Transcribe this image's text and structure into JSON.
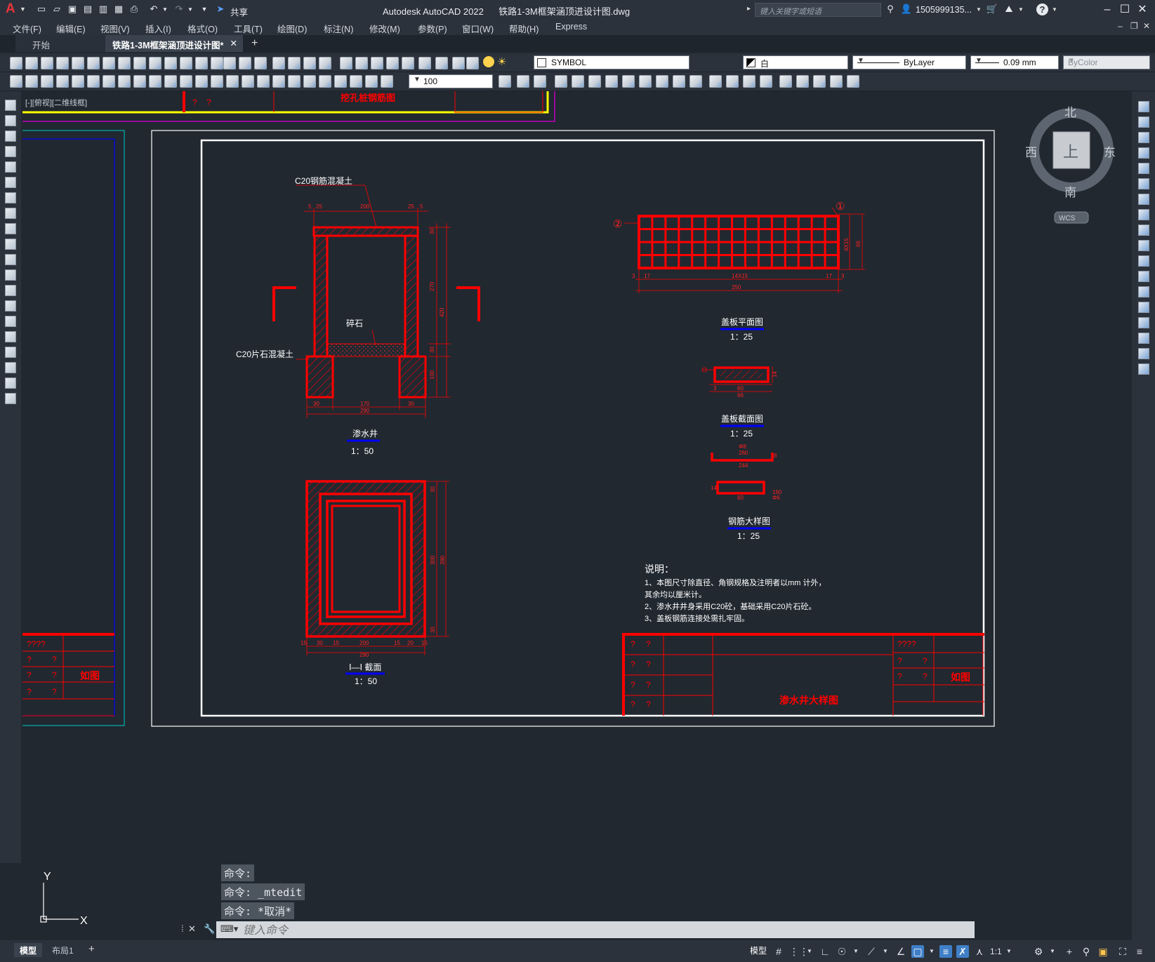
{
  "app": {
    "title": "Autodesk AutoCAD 2022",
    "filename": "铁路1-3M框架涵顶进设计图.dwg",
    "logo": "A",
    "share_label": "共享",
    "search_placeholder": "键入关键字或短语",
    "user": "1505999135...",
    "help": "?"
  },
  "menu": [
    "文件(F)",
    "编辑(E)",
    "视图(V)",
    "插入(I)",
    "格式(O)",
    "工具(T)",
    "绘图(D)",
    "标注(N)",
    "修改(M)",
    "参数(P)",
    "窗口(W)",
    "帮助(H)",
    "Express"
  ],
  "tabs": {
    "start": "开始",
    "active": "铁路1-3M框架涵顶进设计图*",
    "close": "✕",
    "add": "+"
  },
  "toolbar": {
    "layer": "SYMBOL",
    "color": "白",
    "linetype": "ByLayer",
    "lineweight": "0.09 mm",
    "plotstyle": "ByColor",
    "scale": "100"
  },
  "viewport_label": "[-][俯视][二维线框]",
  "viewcube": {
    "north": "北",
    "south": "南",
    "east": "东",
    "west": "西",
    "top": "上",
    "wcs": "WCS"
  },
  "ucs": {
    "x": "X",
    "y": "Y"
  },
  "drawing": {
    "top_strip_title": "挖孔桩钢筋图",
    "top_strip_marks": [
      "?",
      "?"
    ],
    "left_sheet_table": [
      "????",
      "?",
      "?",
      "如图",
      "?",
      "?",
      "?",
      "?"
    ],
    "elev_concrete_label": "C20钢筋混凝土",
    "elev_gravel_label": "碎石",
    "elev_rubble_label": "C20片石混凝土",
    "elev_dims_top": [
      "5",
      "25",
      "200",
      "25",
      "5"
    ],
    "elev_dims_right": [
      "30",
      "270",
      "420",
      "30",
      "100"
    ],
    "elev_dims_bottom": [
      "30",
      "170",
      "30",
      "290"
    ],
    "elev_title": "渗水井",
    "elev_scale": "1：50",
    "section_title": "Ⅰ—Ⅰ 截面",
    "section_scale": "1：50",
    "section_dims_bottom": [
      "15",
      "30",
      "15",
      "200",
      "15",
      "20",
      "15",
      "290"
    ],
    "section_dims_right": [
      "30",
      "390",
      "300",
      "30"
    ],
    "cover_plan_title": "盖板平面图",
    "cover_plan_scale": "1：25",
    "cover_plan_dims": [
      "3",
      "17",
      "14X15",
      "17",
      "3",
      "250"
    ],
    "cover_plan_side": [
      "4X15",
      "66"
    ],
    "cover_plan_marks": [
      "①",
      "②"
    ],
    "cover_section_title": "盖板截面图",
    "cover_section_scale": "1：25",
    "cover_section_dims": [
      "60",
      "66",
      "3",
      "14"
    ],
    "rebar_title": "钢筋大样图",
    "rebar_scale": "1：25",
    "rebar_dims": [
      "Φ8",
      "260",
      "8",
      "244",
      "14",
      "60",
      "160",
      "Φ6"
    ],
    "notes_title": "说明：",
    "notes": [
      "1、本图尺寸除直径、角钢规格及注明者以mm 计外，",
      "其余均以厘米计。",
      "2、渗水井井身采用C20砼，基础采用C20片石砼。",
      "3、盖板钢筋连接处需扎牢固。"
    ],
    "titleblock_marks": [
      "?",
      "?",
      "?",
      "?",
      "?",
      "?",
      "?",
      "?"
    ],
    "titleblock_title": "渗水井大样图",
    "titleblock_right": [
      "????",
      "?",
      "?",
      "如图",
      "?",
      "?"
    ]
  },
  "command": {
    "history": [
      "命令:",
      "命令: _mtedit",
      "命令: *取消*"
    ],
    "placeholder": "键入命令"
  },
  "status": {
    "tab_model": "模型",
    "tab_layout": "布局1",
    "add": "+",
    "model_btn": "模型",
    "scale": "1:1"
  },
  "colors": {
    "background": "#212830",
    "drawing_red": "#ff0000",
    "frame_white": "#ffffff",
    "yellow": "#ffff00",
    "magenta": "#c000c0",
    "cyan": "#00b0b0",
    "blue": "#0000ff",
    "accent": "#3f7fc7"
  }
}
